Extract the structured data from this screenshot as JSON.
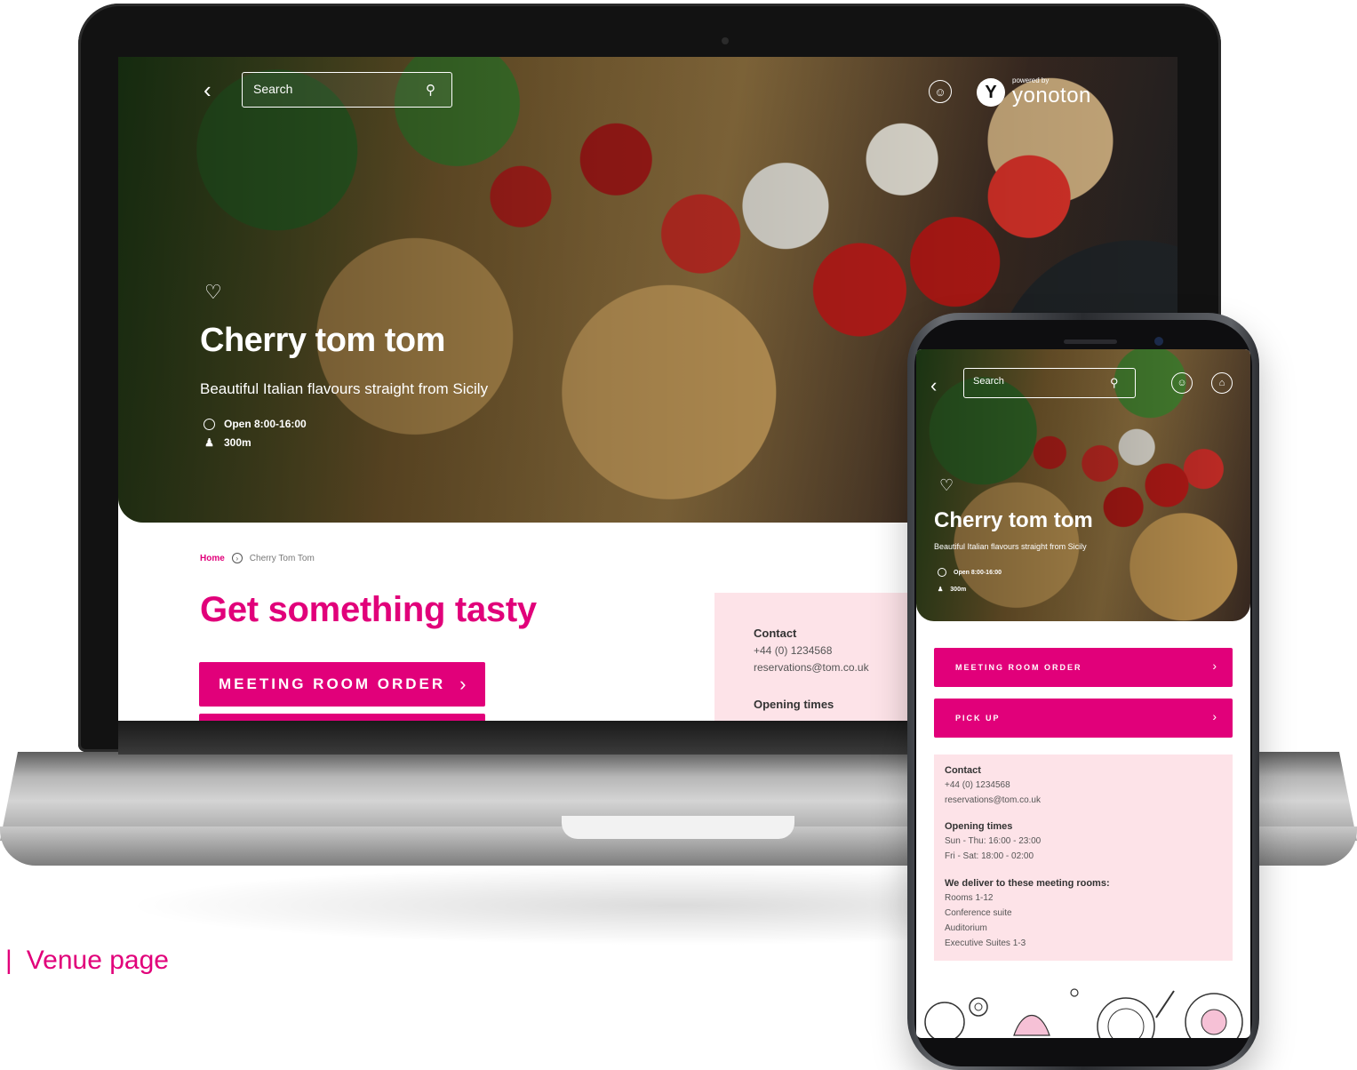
{
  "caption": {
    "separator": "|",
    "label": "Venue page"
  },
  "brand": {
    "accent": "#e1007a",
    "panel": "#fde3e8"
  },
  "desktop": {
    "search": {
      "placeholder": "Search"
    },
    "logo": {
      "powered": "powered by",
      "name": "yonoton"
    },
    "venue": {
      "title": "Cherry tom tom",
      "tagline": "Beautiful Italian flavours straight from Sicily",
      "hours": "Open 8:00-16:00",
      "distance": "300m"
    },
    "breadcrumb": {
      "home": "Home",
      "current": "Cherry Tom Tom"
    },
    "heading": "Get something tasty",
    "buttons": {
      "meeting_room_order": "MEETING ROOM ORDER"
    },
    "info": {
      "contact_title": "Contact",
      "phone": "+44 (0) 1234568",
      "email": "reservations@tom.co.uk",
      "opening_title": "Opening times"
    }
  },
  "mobile": {
    "search": {
      "placeholder": "Search"
    },
    "venue": {
      "title": "Cherry tom tom",
      "tagline": "Beautiful Italian flavours straight from Sicily",
      "hours": "Open 8:00-16:00",
      "distance": "300m"
    },
    "buttons": {
      "meeting_room_order": "MEETING ROOM ORDER",
      "pick_up": "PICK UP"
    },
    "info": {
      "contact_title": "Contact",
      "phone": "+44 (0) 1234568",
      "email": "reservations@tom.co.uk",
      "opening_title": "Opening times",
      "opening_weekdays": "Sun - Thu: 16:00 - 23:00",
      "opening_weekend": "Fri - Sat: 18:00 - 02:00",
      "rooms_title": "We deliver to these meeting rooms:",
      "rooms": [
        "Rooms 1-12",
        "Conference suite",
        "Auditorium",
        "Executive Suites 1-3"
      ]
    }
  }
}
